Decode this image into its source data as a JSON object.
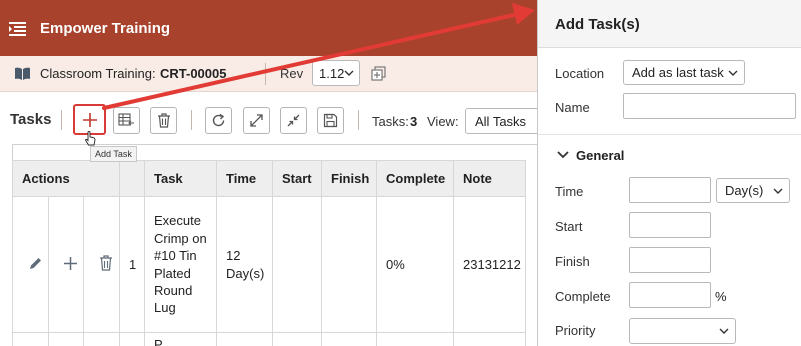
{
  "app": {
    "title": "Empower Training",
    "record_label": "Classroom Training:",
    "record_code": "CRT-00005",
    "rev_label": "Rev",
    "rev_value": "1.12"
  },
  "toolbar": {
    "tasks_title": "Tasks",
    "add_task_tooltip": "Add Task",
    "tasks_count_label": "Tasks:",
    "tasks_count": "3",
    "view_label": "View:",
    "view_value": "All Tasks",
    "buttons": [
      "add-task",
      "import-tasks",
      "delete",
      "refresh",
      "expand",
      "collapse",
      "save"
    ]
  },
  "grid": {
    "headers": {
      "actions": "Actions",
      "task": "Task",
      "time": "Time",
      "start": "Start",
      "finish": "Finish",
      "complete": "Complete",
      "note": "Note"
    },
    "rows": [
      {
        "num": "1",
        "task": "Execute Crimp on #10 Tin Plated Round Lug",
        "time": "12 Day(s)",
        "start": "",
        "finish": "",
        "complete": "0%",
        "note": "23131212"
      }
    ],
    "partial_row_text": "P"
  },
  "panel": {
    "title": "Add Task(s)",
    "location_label": "Location",
    "location_value": "Add as last task",
    "name_label": "Name",
    "name_value": "",
    "section_general": "General",
    "time_label": "Time",
    "time_unit": "Day(s)",
    "start_label": "Start",
    "finish_label": "Finish",
    "complete_label": "Complete",
    "percent_sign": "%",
    "priority_label": "Priority"
  },
  "colors": {
    "topbar": "#a8422c",
    "infobar": "#f9ece7",
    "highlight": "#d93a36",
    "arrow": "#e23b35"
  }
}
